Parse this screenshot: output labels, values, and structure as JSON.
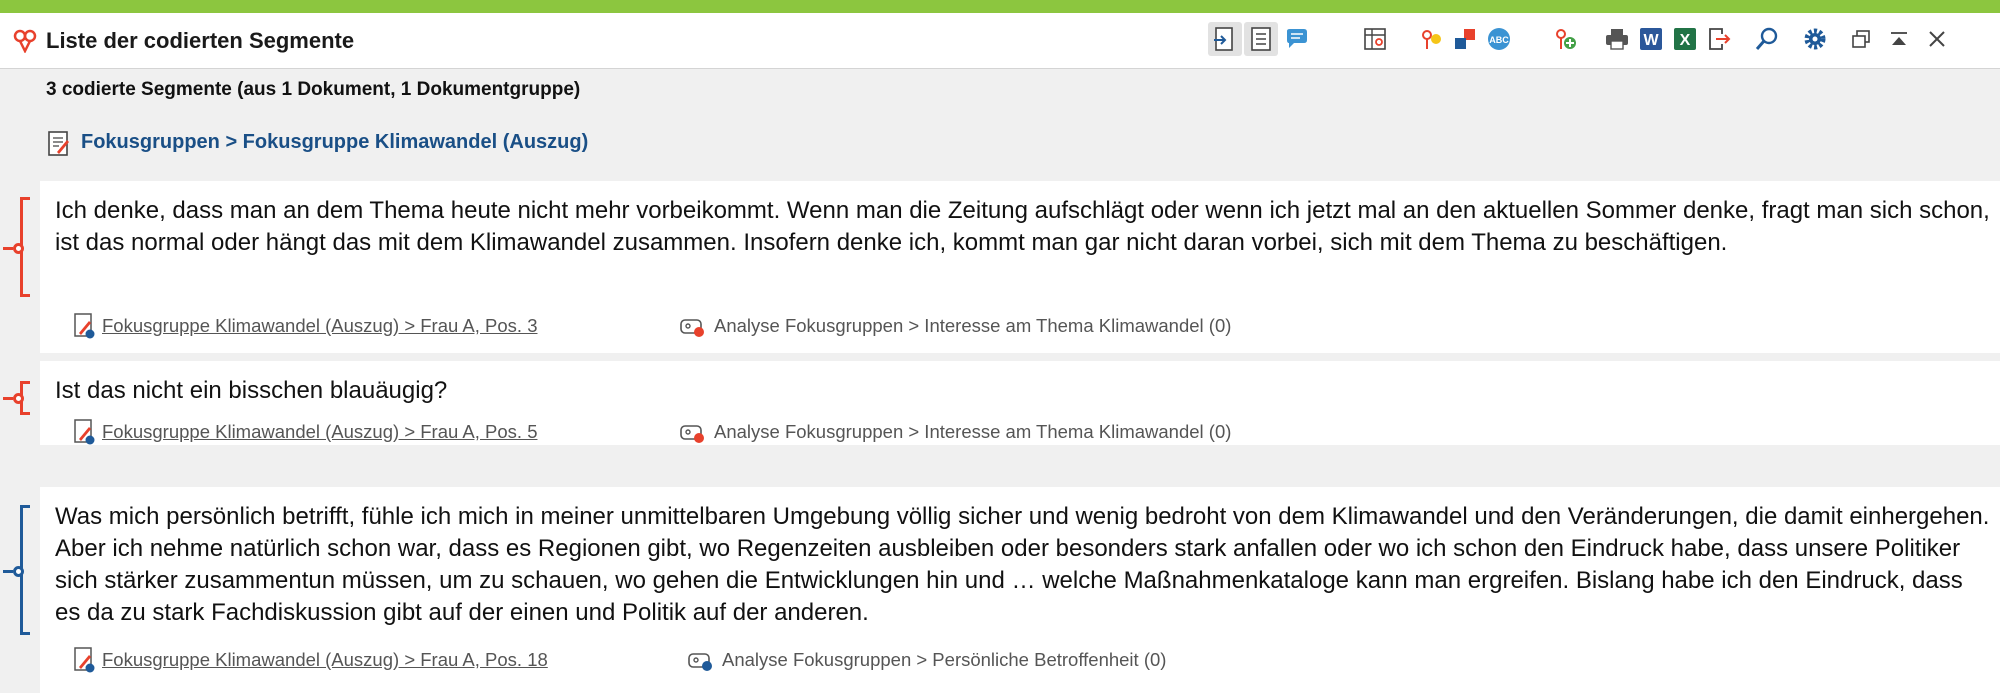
{
  "window": {
    "title": "Liste der codierten Segmente",
    "accent_color": "#8cc63f"
  },
  "toolbar": {
    "icons": [
      "export-icon",
      "list-view-icon",
      "comment-icon",
      "table-view-icon",
      "smart-coding-icon",
      "color-icon",
      "spellcheck-icon",
      "add-code-icon",
      "print-icon",
      "word-export-icon",
      "excel-export-icon",
      "export-file-icon",
      "search-icon",
      "settings-icon",
      "restore-window-icon",
      "minimize-icon",
      "close-icon"
    ]
  },
  "summary": {
    "text": "3 codierte Segmente (aus 1 Dokument, 1 Dokumentgruppe)"
  },
  "document": {
    "link": "Fokusgruppen > Fokusgruppe Klimawandel (Auszug)"
  },
  "segments": [
    {
      "text": "Ich denke, dass man an dem Thema heute nicht mehr vorbeikommt. Wenn man die Zeitung aufschlägt oder wenn ich jetzt mal an den aktuellen Sommer denke, fragt man sich schon, ist das normal oder hängt das mit dem Klimawandel zusammen. Insofern denke ich, kommt man gar nicht daran vorbei, sich mit dem Thema zu beschäftigen.",
      "source": "Fokusgruppe Klimawandel (Auszug) > Frau A, Pos. 3",
      "code": "Analyse Fokusgruppen > Interesse am Thema Klimawandel (0)",
      "code_color": "#e8412c"
    },
    {
      "text": "Ist das nicht ein bisschen blauäugig?",
      "source": "Fokusgruppe Klimawandel (Auszug) > Frau A, Pos. 5",
      "code": "Analyse Fokusgruppen > Interesse am Thema Klimawandel (0)",
      "code_color": "#e8412c"
    },
    {
      "text": "Was mich persönlich betrifft, fühle ich mich in meiner unmittelbaren Umgebung völlig sicher und wenig bedroht von dem Klimawandel und den Veränderungen, die damit einhergehen. Aber ich nehme natürlich schon war, dass es Regionen gibt, wo Regenzeiten ausbleiben oder besonders stark anfallen oder wo ich schon den Eindruck habe, dass unsere Politiker sich stärker zusammentun müssen, um zu schauen, wo gehen die Entwicklungen hin und … welche Maßnahmenkataloge kann man ergreifen. Bislang habe ich den Eindruck, dass es da zu stark Fachdiskussion gibt auf der einen und Politik auf der anderen.",
      "source": "Fokusgruppe Klimawandel (Auszug) > Frau A, Pos. 18",
      "code": "Analyse Fokusgruppen > Persönliche Betroffenheit (0)",
      "code_color": "#1f5a99"
    }
  ]
}
